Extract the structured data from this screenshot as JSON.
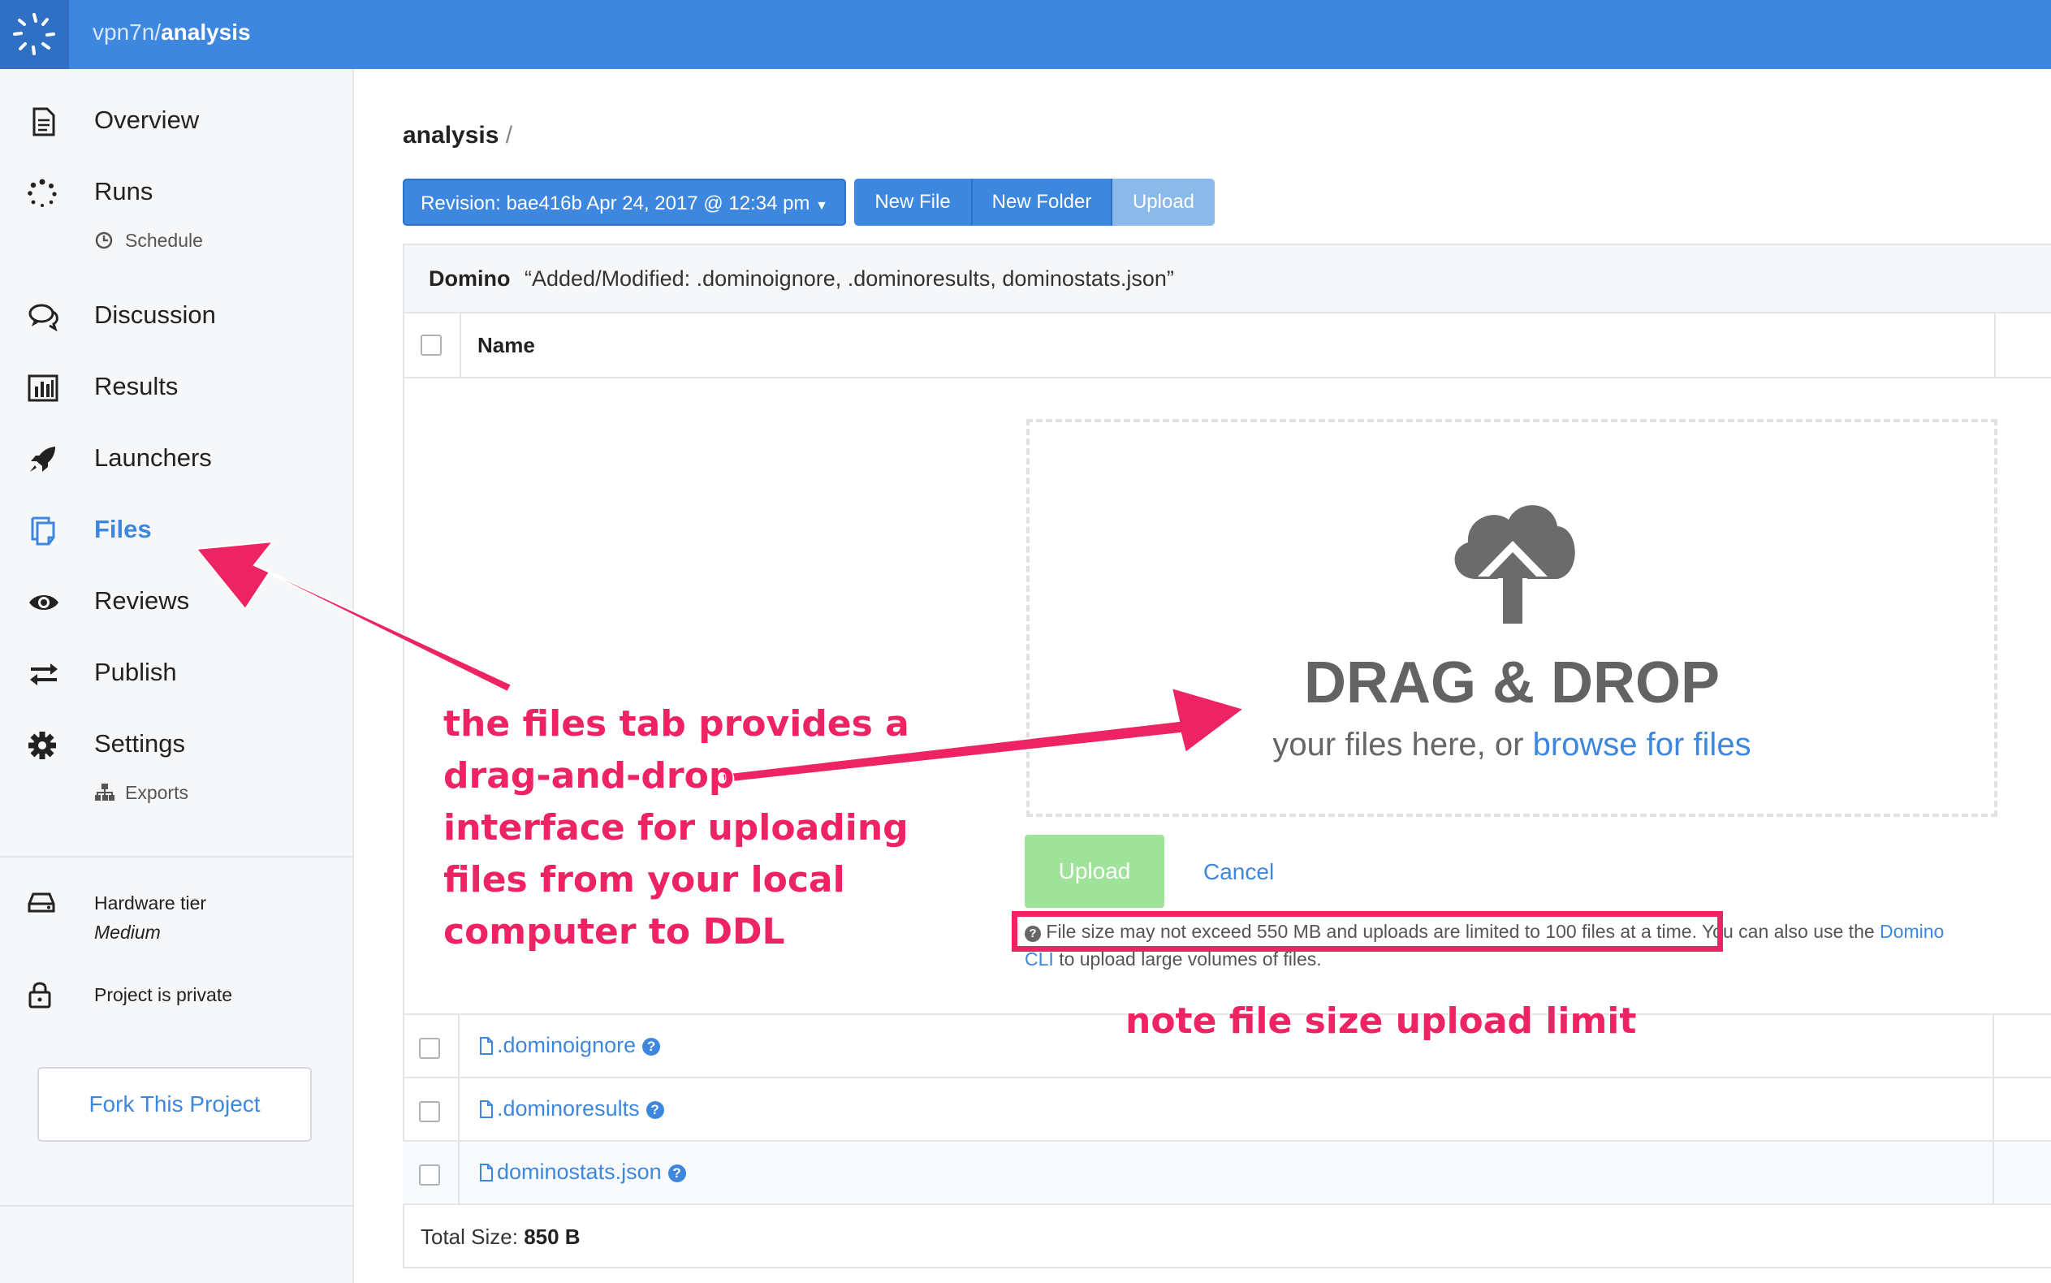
{
  "header": {
    "owner": "vpn7n/",
    "project": "analysis"
  },
  "sidebar": {
    "items": [
      {
        "label": "Overview",
        "icon": "document-icon"
      },
      {
        "label": "Runs",
        "icon": "spinner-icon"
      },
      {
        "label": "Discussion",
        "icon": "chat-icon"
      },
      {
        "label": "Results",
        "icon": "bar-chart-icon"
      },
      {
        "label": "Launchers",
        "icon": "rocket-icon"
      },
      {
        "label": "Files",
        "icon": "files-icon"
      },
      {
        "label": "Reviews",
        "icon": "eye-icon"
      },
      {
        "label": "Publish",
        "icon": "arrows-exchange-icon"
      },
      {
        "label": "Settings",
        "icon": "gear-icon"
      }
    ],
    "schedule_label": "Schedule",
    "exports_label": "Exports",
    "hardware_tier_label": "Hardware tier",
    "hardware_tier_value": "Medium",
    "privacy_label": "Project is private",
    "fork_label": "Fork This Project"
  },
  "main": {
    "path_folder": "analysis",
    "path_slash": "/",
    "revision_label": "Revision: bae416b Apr 24, 2017 @ 12:34 pm",
    "new_file_label": "New File",
    "new_folder_label": "New Folder",
    "upload_label": "Upload",
    "commit_author": "Domino",
    "commit_message": "“Added/Modified: .dominoignore, .dominoresults, dominostats.json”",
    "name_header": "Name",
    "dropzone": {
      "title": "DRAG & DROP",
      "subtitle": "your files here, or",
      "browse_label": "browse for files"
    },
    "upload_button": "Upload",
    "cancel_label": "Cancel",
    "note_text": "File size may not exceed 550 MB and uploads are limited to 100 files at a time. You can also use the",
    "note_link": "Domino",
    "note_link2": "CLI",
    "note_text2": "to upload large volumes of files.",
    "files": [
      {
        "name": ".dominoignore"
      },
      {
        "name": ".dominoresults"
      },
      {
        "name": "dominostats.json"
      }
    ],
    "total_label": "Total Size:",
    "total_value": "850 B"
  },
  "annotations": {
    "main": "the files tab provides a drag-and-drop interface for uploading files from your local computer to DDL",
    "note": "note file size upload limit",
    "color": "#ee2364"
  },
  "colors": {
    "brand": "#3d87de",
    "upload_green": "#9fe39a"
  }
}
